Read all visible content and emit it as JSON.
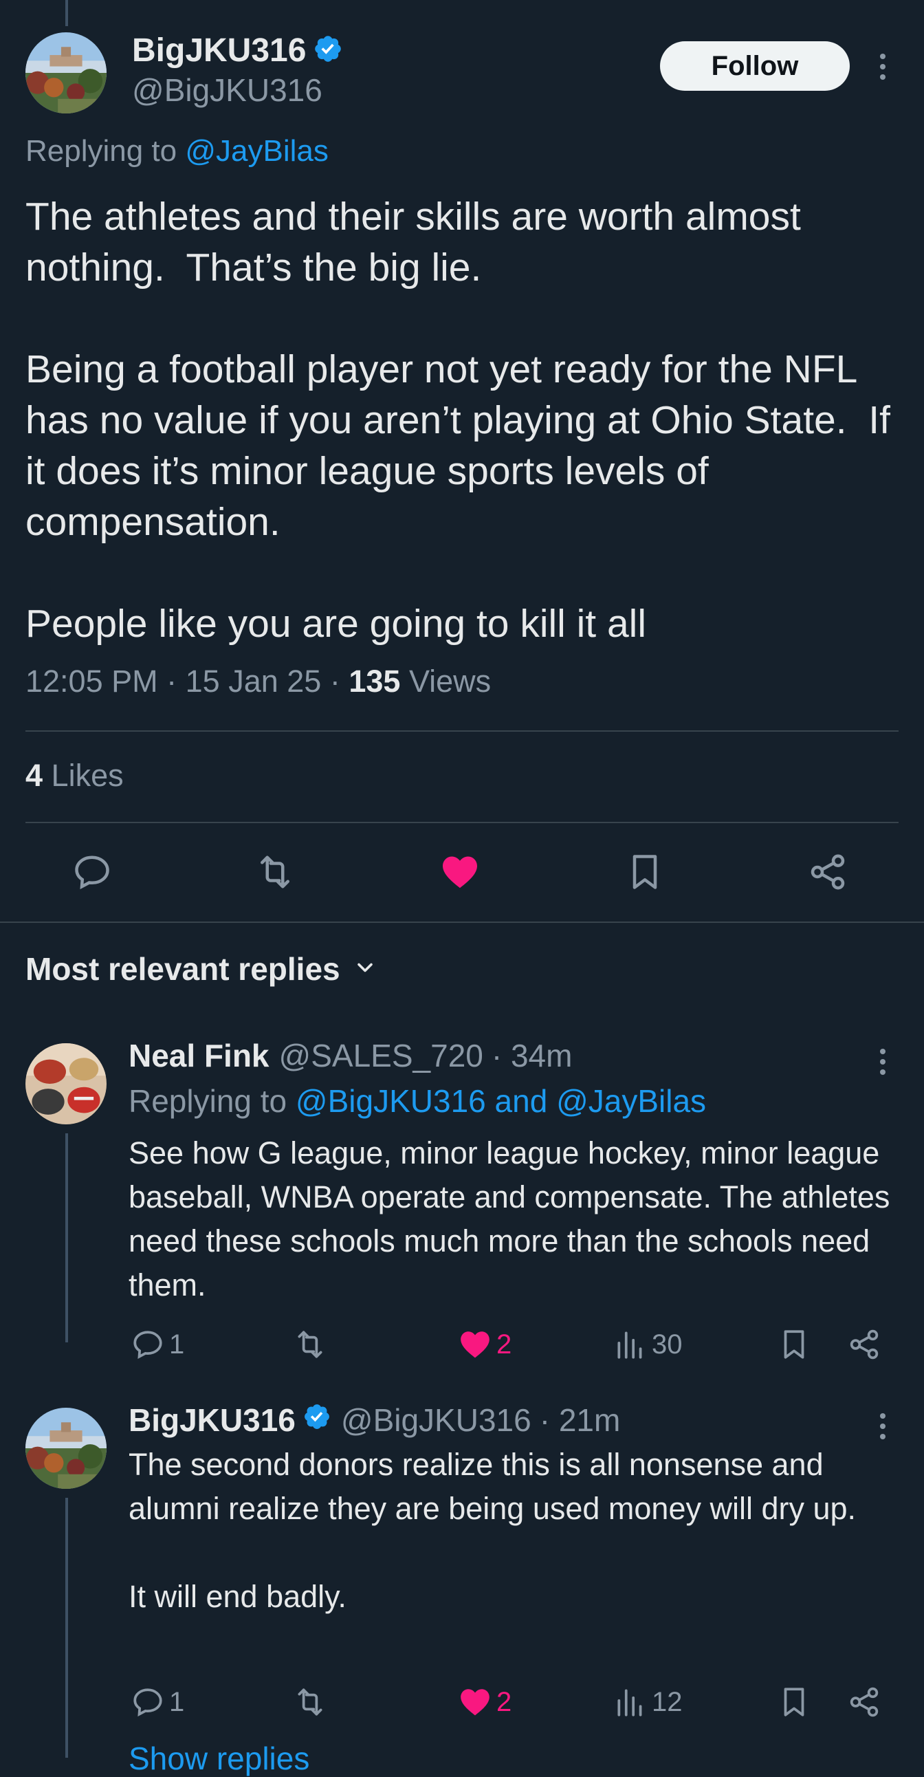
{
  "main_tweet": {
    "display_name": "BigJKU316",
    "handle": "@BigJKU316",
    "follow_label": "Follow",
    "replying_prefix": "Replying to ",
    "replying_to": "@JayBilas",
    "text": "The athletes and their skills are worth almost nothing.  That’s the big lie.\n\nBeing a football player not yet ready for the NFL has no value if you aren’t playing at Ohio State.  If it does it’s minor league sports levels of compensation.\n\nPeople like you are going to kill it all",
    "time": "12:05 PM",
    "date": "15 Jan 25",
    "views_count": "135",
    "views_label": "Views",
    "likes_count": "4",
    "likes_label": "Likes",
    "liked": true
  },
  "section": {
    "title": "Most relevant replies"
  },
  "replies": [
    {
      "display_name": "Neal Fink",
      "handle": "@SALES_720",
      "time": "· 34m",
      "replying_prefix": "Replying to ",
      "replying_to": "@BigJKU316 and @JayBilas",
      "text": "See how G league, minor league hockey, minor league baseball, WNBA operate and compensate. The athletes need these schools much more than the schools need them.",
      "reply_count": "1",
      "like_count": "2",
      "view_count": "30",
      "verified": false
    },
    {
      "display_name": "BigJKU316",
      "handle": "@BigJKU316",
      "time": "· 21m",
      "text": "The second donors realize this is all nonsense and alumni realize they are being used money will dry up.\n\nIt will end badly.",
      "reply_count": "1",
      "like_count": "2",
      "view_count": "12",
      "verified": true
    }
  ],
  "footer": {
    "show_replies": "Show replies"
  },
  "colors": {
    "background": "#15202b",
    "accent": "#1d9bf0",
    "like": "#f91880",
    "muted": "#8b98a5"
  }
}
